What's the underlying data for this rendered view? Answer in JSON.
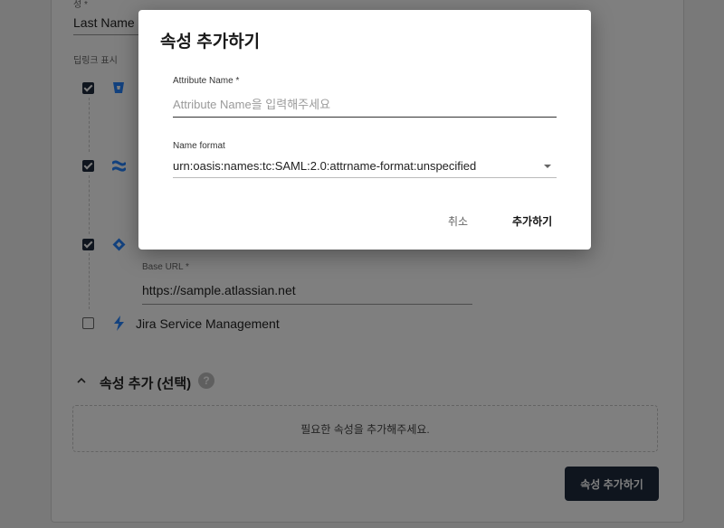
{
  "form": {
    "surname_label": "성 *",
    "surname_value": "Last Name",
    "deeplink_label": "딥링크 표시",
    "apps": [
      {
        "checked": true,
        "name": "",
        "icon": "bitbucket-icon"
      },
      {
        "checked": true,
        "name": "",
        "icon": "confluence-icon"
      },
      {
        "checked": true,
        "name": "",
        "icon": "jira-icon"
      },
      {
        "checked": false,
        "name": "Jira Service Management",
        "icon": "jira-service-management-icon"
      }
    ],
    "base_url_label": "Base URL *",
    "base_url_value": "https://sample.atlassian.net",
    "attributes_section_title": "속성 추가 (선택)",
    "help_glyph": "?",
    "empty_attributes_text": "필요한 속성을 추가해주세요.",
    "add_attribute_button": "속성 추가하기"
  },
  "modal": {
    "title": "속성 추가하기",
    "attribute_name_label": "Attribute Name *",
    "attribute_name_placeholder": "Attribute Name을 입력해주세요",
    "name_format_label": "Name format",
    "name_format_value": "urn:oasis:names:tc:SAML:2.0:attrname-format:unspecified",
    "cancel_label": "취소",
    "confirm_label": "추가하기"
  },
  "colors": {
    "dark_button": "#1f2b3d",
    "atlassian_blue": "#2684ff"
  }
}
